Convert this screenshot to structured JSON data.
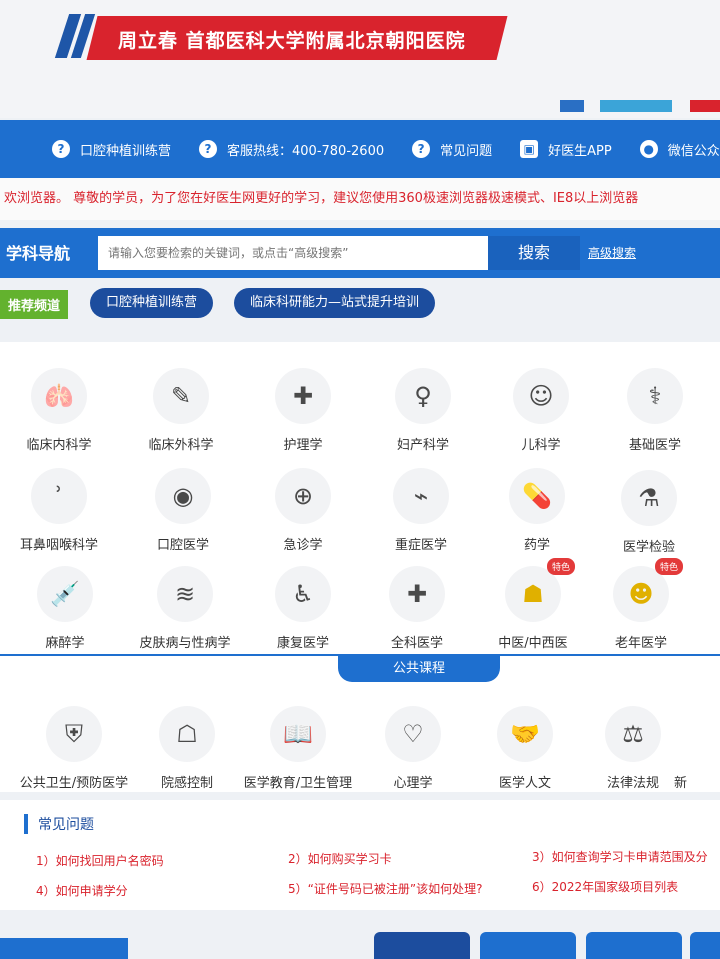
{
  "banner": {
    "title": "周立春 首都医科大学附属北京朝阳医院"
  },
  "topnav": [
    {
      "label": "口腔种植训练营",
      "icon": "question-icon"
    },
    {
      "label": "客服热线：400-780-2600",
      "icon": "question-icon"
    },
    {
      "label": "常见问题",
      "icon": "question-icon"
    },
    {
      "label": "好医生APP",
      "icon": "app-icon"
    },
    {
      "label": "微信公众号",
      "icon": "wechat-icon"
    }
  ],
  "notice": "欢浏览器。 尊敬的学员，为了您在好医生网更好的学习，建议您使用360极速浏览器极速模式、IE8以上浏览器",
  "search": {
    "label": "学科导航",
    "placeholder": "请输入您要检索的关键词，或点击“高级搜索”",
    "button": "搜索",
    "advanced": "高级搜索"
  },
  "reco": {
    "tag": "推荐频道",
    "pills": [
      "口腔种植训练营",
      "临床科研能力—站式提升培训"
    ]
  },
  "subjects": [
    {
      "name": "临床内科学",
      "icon": "lungs-icon",
      "glyph": "🫁"
    },
    {
      "name": "临床外科学",
      "icon": "scalpel-icon",
      "glyph": "✎"
    },
    {
      "name": "护理学",
      "icon": "nursing-cross-icon",
      "glyph": "✚"
    },
    {
      "name": "妇产科学",
      "icon": "pregnancy-icon",
      "glyph": "♀"
    },
    {
      "name": "儿科学",
      "icon": "baby-face-icon",
      "glyph": "☺"
    },
    {
      "name": "基础医学",
      "icon": "stethoscope-icon",
      "glyph": "⚕"
    },
    {
      "name": "耳鼻咽喉科学",
      "icon": "ear-icon",
      "glyph": "ʾ"
    },
    {
      "name": "口腔医学",
      "icon": "mouth-icon",
      "glyph": "◉"
    },
    {
      "name": "急诊学",
      "icon": "emergency-light-icon",
      "glyph": "⊕"
    },
    {
      "name": "重症医学",
      "icon": "monitor-icon",
      "glyph": "⌁"
    },
    {
      "name": "药学",
      "icon": "pill-icon",
      "glyph": "💊"
    },
    {
      "name": "医学检验",
      "icon": "lab-flask-icon",
      "glyph": "⚗"
    },
    {
      "name": "麻醉学",
      "icon": "syringe-icon",
      "glyph": "💉"
    },
    {
      "name": "皮肤病与性病学",
      "icon": "skin-icon",
      "glyph": "≋"
    },
    {
      "name": "康复医学",
      "icon": "walker-icon",
      "glyph": "♿"
    },
    {
      "name": "全科医学",
      "icon": "medical-kit-icon",
      "glyph": "✚"
    },
    {
      "name": "中医/中西医",
      "icon": "mortar-icon",
      "glyph": "☗",
      "badge": "特色"
    },
    {
      "name": "老年医学",
      "icon": "elderly-icon",
      "glyph": "☻",
      "badge": "特色"
    }
  ],
  "public_title": "公共课程",
  "public": [
    {
      "name": "公共卫生/预防医学",
      "icon": "shield-icon",
      "glyph": "⛨"
    },
    {
      "name": "院感控制",
      "icon": "mask-icon",
      "glyph": "☖"
    },
    {
      "name": "医学教育/卫生管理",
      "icon": "book-icon",
      "glyph": "📖"
    },
    {
      "name": "心理学",
      "icon": "heart-hand-icon",
      "glyph": "♡"
    },
    {
      "name": "医学人文",
      "icon": "handshake-icon",
      "glyph": "🤝"
    },
    {
      "name": "法律法规",
      "icon": "scales-icon",
      "glyph": "⚖"
    },
    {
      "name": "新",
      "icon": "new-icon",
      "glyph": ""
    }
  ],
  "faq": {
    "title": "常见问题",
    "items": [
      "1）如何找回用户名密码",
      "2）如何购买学习卡",
      "3）如何查询学习卡申请范围及分",
      "4）如何申请学分",
      "5）“证件号码已被注册”该如何处理?",
      "6）2022年国家级项目列表"
    ]
  }
}
